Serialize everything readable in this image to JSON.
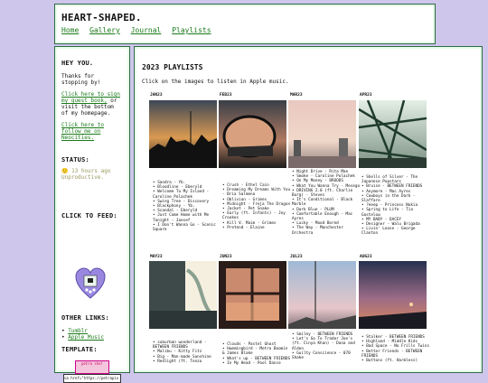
{
  "header": {
    "title": "HEART-SHAPED.",
    "nav": [
      "Home",
      "Gallery",
      "Journal",
      "Playlists"
    ]
  },
  "sidebar": {
    "hey_heading": "HEY YOU.",
    "thanks_text": "Thanks for stopping by!",
    "guestbook_link": "Click here to sign my guest book,",
    "guestbook_tail": "or visit the bottom of my homepage.",
    "neocities_link": "Click here to follow me on Neocities.",
    "status_heading": "STATUS:",
    "status_emoji": "🙂",
    "status_time": "13 hours ago",
    "status_text": "Unproductive.",
    "feed_heading": "CLICK TO FEED:",
    "other_heading": "OTHER LINKS:",
    "other_links": [
      "Tumblr",
      "Apple Music"
    ],
    "template_heading": "TEMPLATE:",
    "button_text": "petra\nshe!",
    "code_text": "<a href=\"https://petrapix"
  },
  "main": {
    "title": "2023 PLAYLISTS",
    "intro": "Click on the images to listen in Apple music.",
    "months": [
      {
        "label": "JAN23",
        "tracks": [
          "Sandra - Yb.",
          "Bloodline - Eberyld",
          "Welcome To My Island - Caroline Polachek",
          "Swing Tree - Discovery",
          "Blackphony - Yb.",
          "Scandal - Eberyld",
          "Just Come Home with Me Tonight - Joesef",
          "I Don't Wanna Go - Scenic Square"
        ]
      },
      {
        "label": "FEB23",
        "tracks": [
          "Crush - Ethel Cain",
          "Dreaming My Dreams With You - Bria Salmena",
          "Oblivion - Grimes",
          "Midnight - Freja The Dragon",
          "Jacket - Pet Snake",
          "Early (ft. Infants) - Joy Crookes",
          "Kill V. Maim - Grimes",
          "Pretend - Elaine"
        ]
      },
      {
        "label": "MAR23",
        "tracks": [
          "Night Drive - Rita Mae",
          "Smoke - Caroline Polachek",
          "On My Money - BROODS",
          "What You Wanna Try - Mesego",
          "DRIVING 2.0 (ft. Charlie Burg) - Steves",
          "It's Conditional - Black Marble",
          "Dark Blue - PLUM",
          "Comfortable Enough - Mac Ayres",
          "Lucky - Mood Bored",
          "The Way - Manchester Orchestra"
        ]
      },
      {
        "label": "APR23",
        "tracks": [
          "Shells of Silver - The Japanese Popstars",
          "Bruise - BETWEEN FRIENDS",
          "Anymore - Mac Ayres",
          "Cowboys in the Dark - Slaffare",
          "?eeep - Princess Nokia",
          "Spring to Life - Tia Gostelow",
          "MY BABY - DACEY",
          "Designer - Walu Brigada",
          "Livin' Loose - George Clanton"
        ]
      },
      {
        "label": "MAY23",
        "tracks": [
          "suburban wonderland - BETWEEN FRIENDS",
          "Malibu - Kitty Fitz",
          "Big - Man-made Sunshine",
          "Redlight (ft. Tenzo"
        ]
      },
      {
        "label": "JUN23",
        "tracks": [
          "Clouds - Pastel Ghost",
          "Hummingbird - Metro Boomin & James Blake",
          "What's up - BETWEEN FRIENDS",
          "In My Head - Pool Dance"
        ]
      },
      {
        "label": "JUL23",
        "tracks": [
          "Smiley - BETWEEN FRIENDS",
          "Let's Go To Trader Joe's (ft. Cinya Khan) - Dana and Alden",
          "Guilty Conscience - 070 Shake"
        ]
      },
      {
        "label": "AUG23",
        "tracks": [
          "Stalker - BETWEEN FRIENDS",
          "Highland - Middle Kids",
          "Bad Space - No Frills Twins",
          "Better Friends - BETWEEN FRIENDS",
          "Buttons (ft. Harmless)"
        ]
      }
    ]
  }
}
